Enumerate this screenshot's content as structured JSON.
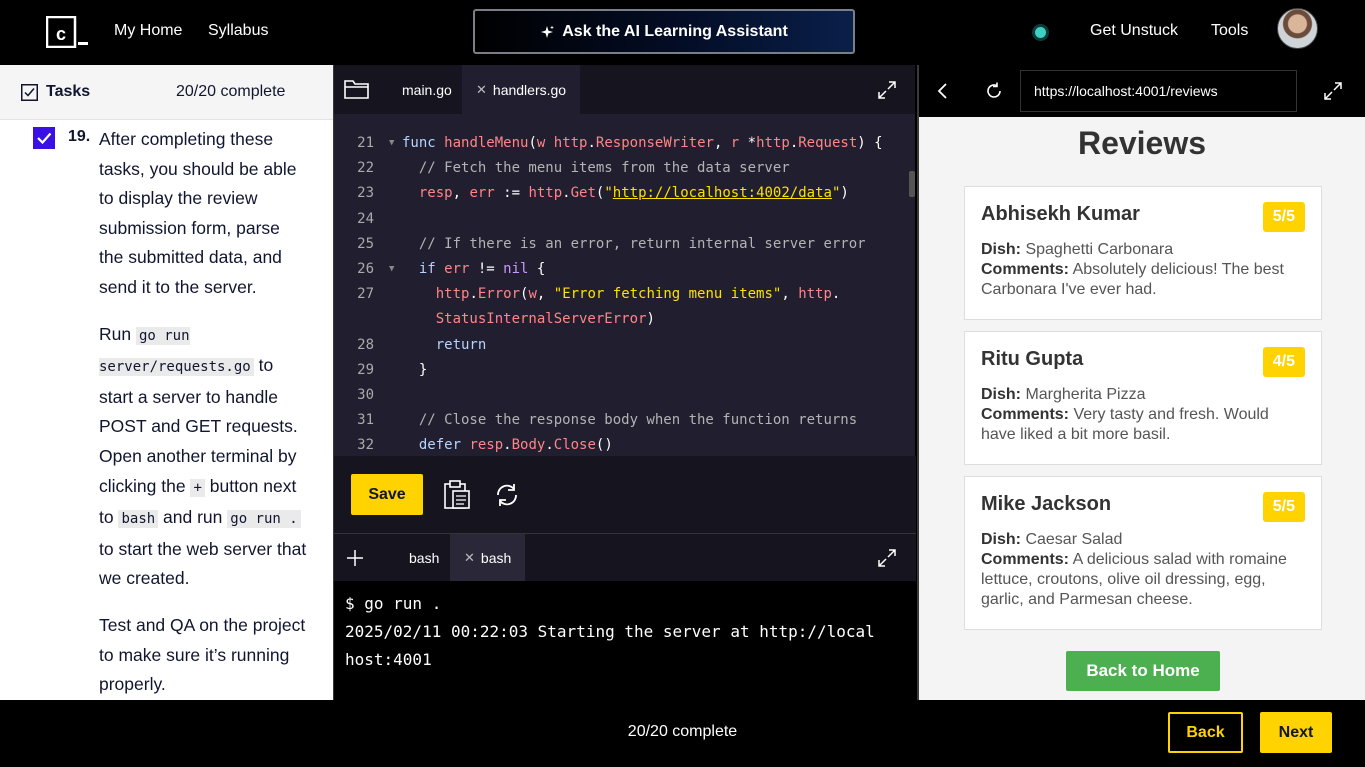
{
  "nav": {
    "logo_icon": "codecademy-logo-icon",
    "my_home": "My Home",
    "syllabus": "Syllabus",
    "ai_button": "Ask the AI Learning Assistant",
    "get_unstuck": "Get Unstuck",
    "tools": "Tools"
  },
  "tasks": {
    "title": "Tasks",
    "count": "20/20 complete",
    "item": {
      "number": "19.",
      "checked": true,
      "p1": "After completing these tasks, you should be able to display the review submission form, parse the submitted data, and send it to the server.",
      "p2_run": "Run ",
      "p2_code1": "go run server/requests.go",
      "p2_mid": " to start a server to handle POST and GET requests. Open another terminal by clicking the ",
      "p2_code2": "+",
      "p2_mid2": " button next to ",
      "p2_code3": "bash",
      "p2_mid3": " and run ",
      "p2_code4": "go run .",
      "p2_end": " to start the web server that we created.",
      "p3": "Test and QA on the project to make sure it’s running properly."
    }
  },
  "editor": {
    "tabs": [
      {
        "label": "main.go",
        "active": false
      },
      {
        "label": "handlers.go",
        "active": true
      }
    ],
    "line_numbers": [
      "21",
      "22",
      "23",
      "24",
      "25",
      "26",
      "27",
      "",
      "28",
      "29",
      "30",
      "31",
      "32"
    ],
    "save_label": "Save"
  },
  "terminal": {
    "tabs": [
      "bash",
      "bash"
    ],
    "lines": [
      "$ go run .",
      "2025/02/11 00:22:03 Starting the server at http://local",
      "host:4001"
    ]
  },
  "browser": {
    "url": "https://localhost:4001/reviews",
    "page_title": "Reviews",
    "reviews": [
      {
        "name": "Abhisekh Kumar",
        "rating": "5/5",
        "dish_label": "Dish:",
        "dish": "Spaghetti Carbonara",
        "comments_label": "Comments:",
        "comments": "Absolutely delicious! The best Carbonara I've ever had."
      },
      {
        "name": "Ritu Gupta",
        "rating": "4/5",
        "dish_label": "Dish:",
        "dish": "Margherita Pizza",
        "comments_label": "Comments:",
        "comments": "Very tasty and fresh. Would have liked a bit more basil."
      },
      {
        "name": "Mike Jackson",
        "rating": "5/5",
        "dish_label": "Dish:",
        "dish": "Caesar Salad",
        "comments_label": "Comments:",
        "comments": "A delicious salad with romaine lettuce, croutons, olive oil dressing, egg, garlic, and Parmesan cheese."
      }
    ],
    "back_home": "Back to Home"
  },
  "footer": {
    "progress": "20/20 complete",
    "back": "Back",
    "next": "Next"
  },
  "colors": {
    "accent_yellow": "#ffd300",
    "checkbox_blue": "#3a10e5",
    "home_green": "#4caf50",
    "status_teal": "#3fd0c4"
  }
}
